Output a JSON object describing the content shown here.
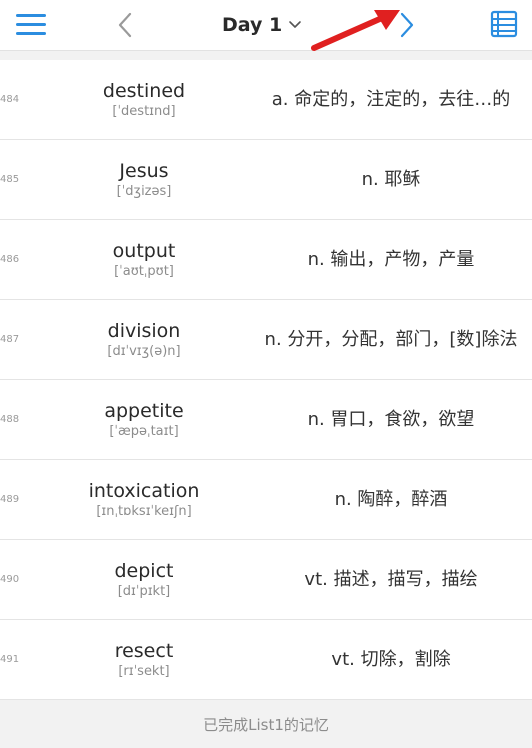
{
  "header": {
    "title": "Day 1",
    "menu_icon": "menu-icon",
    "prev_icon": "chevron-left-icon",
    "next_icon": "chevron-right-icon",
    "list_icon": "list-view-icon",
    "accent_color": "#2b8de0",
    "annotation_color": "#e02020"
  },
  "words": [
    {
      "index": "484",
      "word": "destined",
      "phonetic": "[ˈdestɪnd]",
      "meaning": "a. 命定的，注定的，去往…的"
    },
    {
      "index": "485",
      "word": "Jesus",
      "phonetic": "[ˈdʒizəs]",
      "meaning": "n. 耶稣"
    },
    {
      "index": "486",
      "word": "output",
      "phonetic": "[ˈaʊtˌpʊt]",
      "meaning": "n. 输出，产物，产量"
    },
    {
      "index": "487",
      "word": "division",
      "phonetic": "[dɪˈvɪʒ(ə)n]",
      "meaning": "n. 分开，分配，部门，[数]除法"
    },
    {
      "index": "488",
      "word": "appetite",
      "phonetic": "[ˈæpəˌtaɪt]",
      "meaning": "n. 胃口，食欲，欲望"
    },
    {
      "index": "489",
      "word": "intoxication",
      "phonetic": "[ɪnˌtɒksɪˈkeɪʃn]",
      "meaning": "n. 陶醉，醉酒"
    },
    {
      "index": "490",
      "word": "depict",
      "phonetic": "[dɪˈpɪkt]",
      "meaning": "vt. 描述，描写，描绘"
    },
    {
      "index": "491",
      "word": "resect",
      "phonetic": "[rɪˈsekt]",
      "meaning": "vt. 切除，割除"
    }
  ],
  "footer": {
    "text": "已完成List1的记忆"
  }
}
